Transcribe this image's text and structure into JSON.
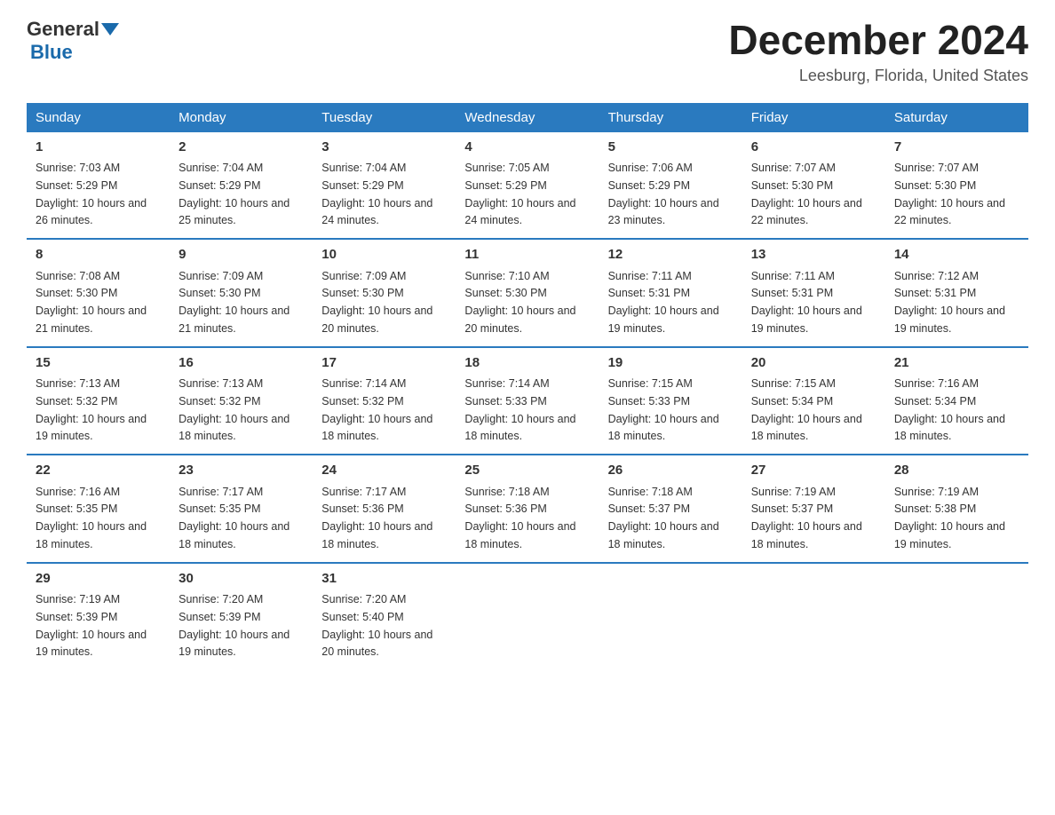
{
  "logo": {
    "line1": "General",
    "triangle": "▼",
    "line2": "Blue"
  },
  "title": {
    "month_year": "December 2024",
    "location": "Leesburg, Florida, United States"
  },
  "days_of_week": [
    "Sunday",
    "Monday",
    "Tuesday",
    "Wednesday",
    "Thursday",
    "Friday",
    "Saturday"
  ],
  "weeks": [
    [
      {
        "day": "1",
        "sunrise": "7:03 AM",
        "sunset": "5:29 PM",
        "daylight": "10 hours and 26 minutes."
      },
      {
        "day": "2",
        "sunrise": "7:04 AM",
        "sunset": "5:29 PM",
        "daylight": "10 hours and 25 minutes."
      },
      {
        "day": "3",
        "sunrise": "7:04 AM",
        "sunset": "5:29 PM",
        "daylight": "10 hours and 24 minutes."
      },
      {
        "day": "4",
        "sunrise": "7:05 AM",
        "sunset": "5:29 PM",
        "daylight": "10 hours and 24 minutes."
      },
      {
        "day": "5",
        "sunrise": "7:06 AM",
        "sunset": "5:29 PM",
        "daylight": "10 hours and 23 minutes."
      },
      {
        "day": "6",
        "sunrise": "7:07 AM",
        "sunset": "5:30 PM",
        "daylight": "10 hours and 22 minutes."
      },
      {
        "day": "7",
        "sunrise": "7:07 AM",
        "sunset": "5:30 PM",
        "daylight": "10 hours and 22 minutes."
      }
    ],
    [
      {
        "day": "8",
        "sunrise": "7:08 AM",
        "sunset": "5:30 PM",
        "daylight": "10 hours and 21 minutes."
      },
      {
        "day": "9",
        "sunrise": "7:09 AM",
        "sunset": "5:30 PM",
        "daylight": "10 hours and 21 minutes."
      },
      {
        "day": "10",
        "sunrise": "7:09 AM",
        "sunset": "5:30 PM",
        "daylight": "10 hours and 20 minutes."
      },
      {
        "day": "11",
        "sunrise": "7:10 AM",
        "sunset": "5:30 PM",
        "daylight": "10 hours and 20 minutes."
      },
      {
        "day": "12",
        "sunrise": "7:11 AM",
        "sunset": "5:31 PM",
        "daylight": "10 hours and 19 minutes."
      },
      {
        "day": "13",
        "sunrise": "7:11 AM",
        "sunset": "5:31 PM",
        "daylight": "10 hours and 19 minutes."
      },
      {
        "day": "14",
        "sunrise": "7:12 AM",
        "sunset": "5:31 PM",
        "daylight": "10 hours and 19 minutes."
      }
    ],
    [
      {
        "day": "15",
        "sunrise": "7:13 AM",
        "sunset": "5:32 PM",
        "daylight": "10 hours and 19 minutes."
      },
      {
        "day": "16",
        "sunrise": "7:13 AM",
        "sunset": "5:32 PM",
        "daylight": "10 hours and 18 minutes."
      },
      {
        "day": "17",
        "sunrise": "7:14 AM",
        "sunset": "5:32 PM",
        "daylight": "10 hours and 18 minutes."
      },
      {
        "day": "18",
        "sunrise": "7:14 AM",
        "sunset": "5:33 PM",
        "daylight": "10 hours and 18 minutes."
      },
      {
        "day": "19",
        "sunrise": "7:15 AM",
        "sunset": "5:33 PM",
        "daylight": "10 hours and 18 minutes."
      },
      {
        "day": "20",
        "sunrise": "7:15 AM",
        "sunset": "5:34 PM",
        "daylight": "10 hours and 18 minutes."
      },
      {
        "day": "21",
        "sunrise": "7:16 AM",
        "sunset": "5:34 PM",
        "daylight": "10 hours and 18 minutes."
      }
    ],
    [
      {
        "day": "22",
        "sunrise": "7:16 AM",
        "sunset": "5:35 PM",
        "daylight": "10 hours and 18 minutes."
      },
      {
        "day": "23",
        "sunrise": "7:17 AM",
        "sunset": "5:35 PM",
        "daylight": "10 hours and 18 minutes."
      },
      {
        "day": "24",
        "sunrise": "7:17 AM",
        "sunset": "5:36 PM",
        "daylight": "10 hours and 18 minutes."
      },
      {
        "day": "25",
        "sunrise": "7:18 AM",
        "sunset": "5:36 PM",
        "daylight": "10 hours and 18 minutes."
      },
      {
        "day": "26",
        "sunrise": "7:18 AM",
        "sunset": "5:37 PM",
        "daylight": "10 hours and 18 minutes."
      },
      {
        "day": "27",
        "sunrise": "7:19 AM",
        "sunset": "5:37 PM",
        "daylight": "10 hours and 18 minutes."
      },
      {
        "day": "28",
        "sunrise": "7:19 AM",
        "sunset": "5:38 PM",
        "daylight": "10 hours and 19 minutes."
      }
    ],
    [
      {
        "day": "29",
        "sunrise": "7:19 AM",
        "sunset": "5:39 PM",
        "daylight": "10 hours and 19 minutes."
      },
      {
        "day": "30",
        "sunrise": "7:20 AM",
        "sunset": "5:39 PM",
        "daylight": "10 hours and 19 minutes."
      },
      {
        "day": "31",
        "sunrise": "7:20 AM",
        "sunset": "5:40 PM",
        "daylight": "10 hours and 20 minutes."
      },
      {
        "day": "",
        "sunrise": "",
        "sunset": "",
        "daylight": ""
      },
      {
        "day": "",
        "sunrise": "",
        "sunset": "",
        "daylight": ""
      },
      {
        "day": "",
        "sunrise": "",
        "sunset": "",
        "daylight": ""
      },
      {
        "day": "",
        "sunrise": "",
        "sunset": "",
        "daylight": ""
      }
    ]
  ],
  "labels": {
    "sunrise": "Sunrise:",
    "sunset": "Sunset:",
    "daylight": "Daylight:"
  }
}
